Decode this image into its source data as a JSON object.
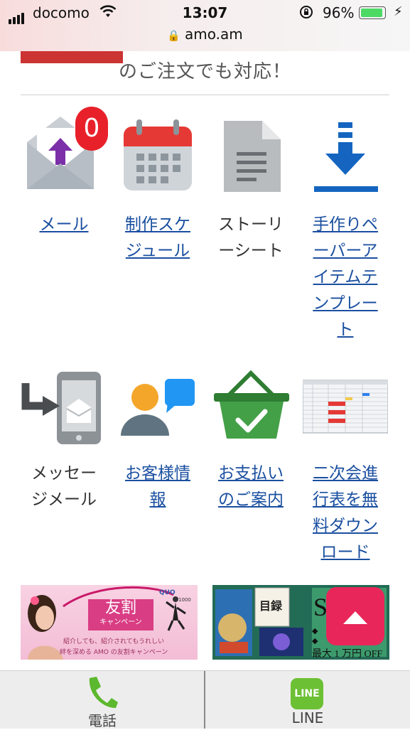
{
  "status_bar": {
    "carrier": "docomo",
    "time": "13:07",
    "battery_percent": "96%",
    "battery_level": 0.96,
    "url": "amo.am"
  },
  "headline": "のご注文でも対応！",
  "grid": [
    {
      "label": "メール",
      "link": true,
      "icon": "mail-upload-icon",
      "badge": "0"
    },
    {
      "label": "制作スケ\nジュール",
      "link": true,
      "icon": "calendar-icon"
    },
    {
      "label": "ストーリ\nーシート",
      "link": false,
      "icon": "document-icon"
    },
    {
      "label": "手作りペ\nーパーア\nイテムテ\nンプレー\nト",
      "link": true,
      "icon": "download-icon"
    },
    {
      "label": "メッセー\nジメール",
      "link": false,
      "icon": "message-mail-icon"
    },
    {
      "label": "お客様情\n報",
      "link": true,
      "icon": "customer-chat-icon"
    },
    {
      "label": "お支払い\nのご案内",
      "link": true,
      "icon": "payment-basket-icon"
    },
    {
      "label": "二次会進\n行表を無\n料ダウン\nロード",
      "link": true,
      "icon": "spreadsheet-thumbnail-icon"
    }
  ],
  "banners": {
    "left": {
      "title": "友割",
      "subtitle": "キャンペーン",
      "line1": "紹介しても、紹介されてもうれしい",
      "line2": "絆を深める AMO の友割キャンペーン",
      "quo": "QUO",
      "quo_amount": "1000"
    },
    "right": {
      "book_label": "目録",
      "title_letter": "S",
      "line1": "◆",
      "line2": "◆",
      "discount": "最大 1 万円 OFF"
    }
  },
  "bottom_bar": {
    "phone_label": "電話",
    "line_label": "LINE",
    "line_logo_text": "LINE"
  },
  "colors": {
    "link": "#1a4fa0",
    "up_button": "#e8265a",
    "accent_red": "#cc3333",
    "phone_green": "#5cb82e",
    "line_green": "#6cc033"
  }
}
